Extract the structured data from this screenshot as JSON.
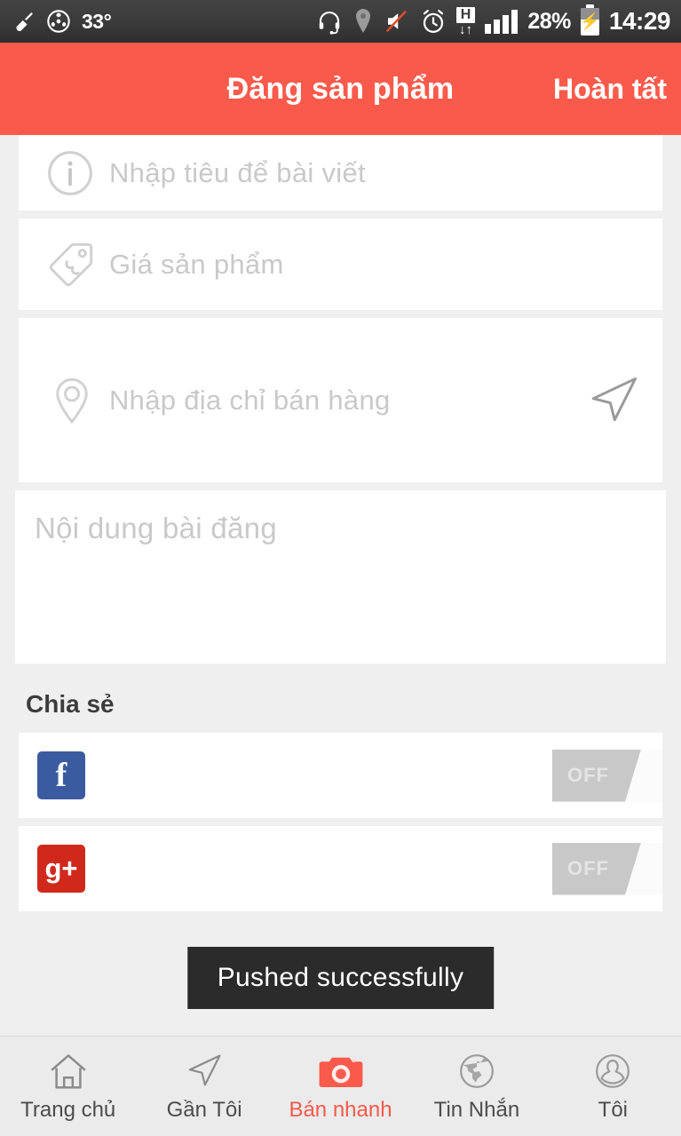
{
  "statusbar": {
    "left_icons": [
      "broom-cleaner-icon",
      "fan-icon"
    ],
    "temperature": "33°",
    "right_icons": [
      "headset-icon",
      "location-pin-icon",
      "mute-speaker-icon",
      "alarm-clock-icon",
      "hspa-network-icon",
      "signal-bars-icon"
    ],
    "network_label": "H",
    "battery_percent": "28%",
    "battery_state": "charging",
    "clock": "14:29"
  },
  "header": {
    "title": "Đăng sản phẩm",
    "action_label": "Hoàn tất",
    "background": "#fa5a4b"
  },
  "form": {
    "title_field": {
      "icon": "info-circle-icon",
      "placeholder": "Nhập tiêu để bài viết",
      "value": ""
    },
    "price_field": {
      "icon": "price-tag-icon",
      "placeholder": "Giá sản phẩm",
      "value": ""
    },
    "address_field": {
      "icon": "map-pin-icon",
      "placeholder": "Nhập địa chỉ bán hàng",
      "value": "",
      "action_icon": "navigation-arrow-icon"
    },
    "body_field": {
      "placeholder": "Nội dung bài đăng",
      "value": ""
    }
  },
  "share": {
    "section_label": "Chia sẻ",
    "items": [
      {
        "name": "facebook",
        "icon": "facebook-icon",
        "glyph": "f",
        "color": "#3b5ba0",
        "toggle_label": "OFF",
        "toggle_state": "off"
      },
      {
        "name": "google-plus",
        "icon": "google-plus-icon",
        "glyph": "g+",
        "color": "#d0291c",
        "toggle_label": "OFF",
        "toggle_state": "off"
      }
    ]
  },
  "toast": {
    "message": "Pushed successfully"
  },
  "tabbar": {
    "accent": "#fa5a4b",
    "items": [
      {
        "label": "Trang chủ",
        "icon": "home-icon",
        "active": false
      },
      {
        "label": "Gần Tôi",
        "icon": "navigation-arrow-icon",
        "active": false
      },
      {
        "label": "Bán nhanh",
        "icon": "camera-icon",
        "active": true
      },
      {
        "label": "Tin Nhắn",
        "icon": "globe-icon",
        "active": false
      },
      {
        "label": "Tôi",
        "icon": "person-avatar-icon",
        "active": false
      }
    ]
  }
}
